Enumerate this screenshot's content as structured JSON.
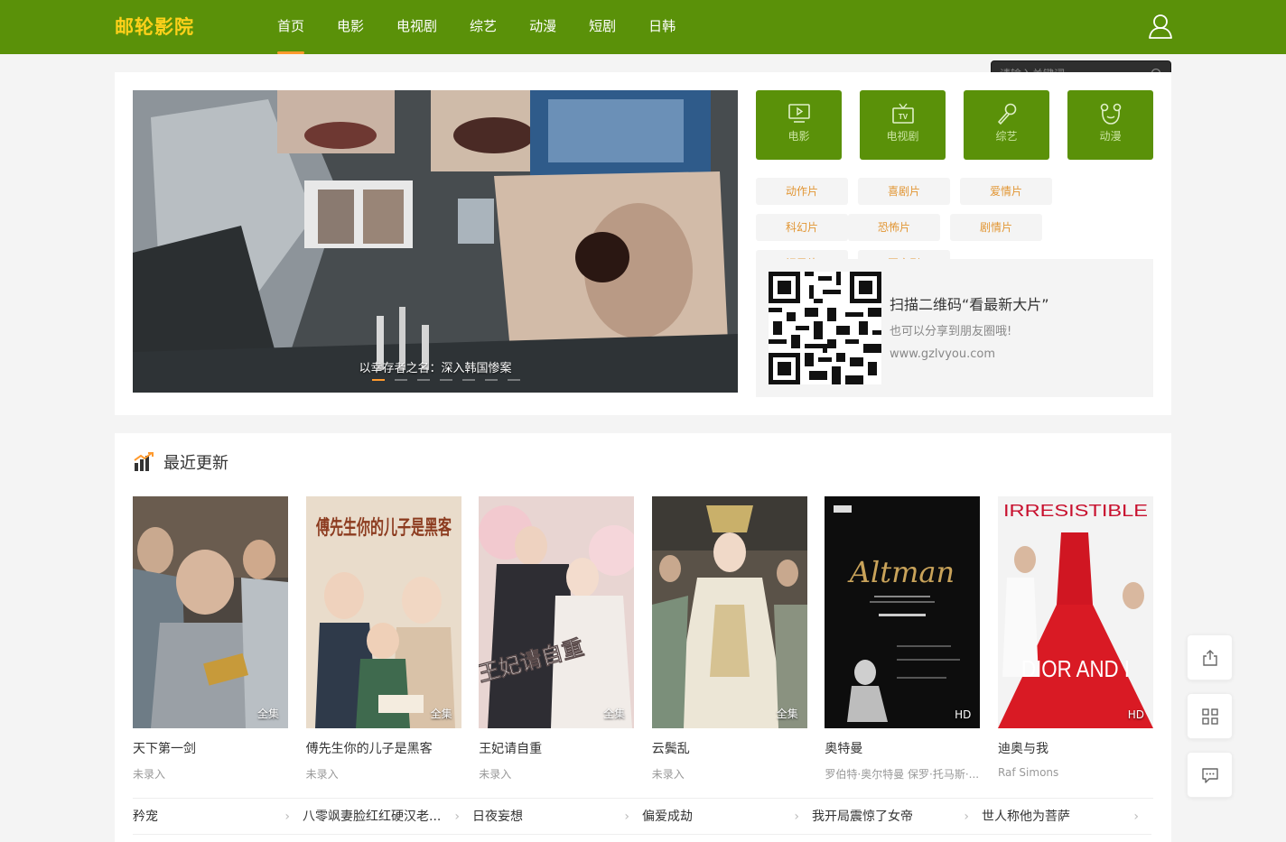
{
  "header": {
    "logo": "邮轮影院",
    "nav": [
      "首页",
      "电影",
      "电视剧",
      "综艺",
      "动漫",
      "短剧",
      "日韩"
    ],
    "active_nav": 0
  },
  "search": {
    "placeholder": "请输入关键词..."
  },
  "banner": {
    "caption": "以幸存者之名：深入韩国惨案",
    "slide_count": 7,
    "active_slide": 0
  },
  "categories": [
    {
      "label": "电影",
      "icon": "play-screen-icon"
    },
    {
      "label": "电视剧",
      "icon": "tv-icon"
    },
    {
      "label": "综艺",
      "icon": "microphone-icon"
    },
    {
      "label": "动漫",
      "icon": "bear-icon"
    }
  ],
  "genres": [
    "动作片",
    "喜剧片",
    "爱情片",
    "科幻片",
    "恐怖片",
    "剧情片",
    "记录片",
    "国产剧"
  ],
  "qr": {
    "title": "扫描二维码“看最新大片”",
    "subtitle": "也可以分享到朋友圈哦!",
    "url": "www.gzlvyou.com"
  },
  "recent": {
    "title": "最近更新",
    "items": [
      {
        "title": "天下第一剑",
        "sub": "未录入",
        "badge": "全集"
      },
      {
        "title": "傅先生你的儿子是黑客",
        "sub": "未录入",
        "badge": "全集",
        "poster_text": "傅先生你的儿子是黑客"
      },
      {
        "title": "王妃请自重",
        "sub": "未录入",
        "badge": "全集",
        "poster_text": "王妃请自重"
      },
      {
        "title": "云鬓乱",
        "sub": "未录入",
        "badge": "全集"
      },
      {
        "title": "奥特曼",
        "sub": "罗伯特·奥尔特曼 保罗·托马斯·...",
        "badge": "HD",
        "poster_text": "Altman"
      },
      {
        "title": "迪奥与我",
        "sub": "Raf Simons",
        "badge": "HD",
        "poster_text": "IRRESISTIBLE",
        "poster_text2": "DIOR AND I"
      }
    ],
    "more": [
      "矜宠",
      "八零飒妻脸红红硬汉老...",
      "日夜妄想",
      "偏爱成劫",
      "我开局震惊了女帝",
      "世人称他为菩萨"
    ]
  },
  "colors": {
    "brand": "#5a9109",
    "accent": "#ff9a2e",
    "logo": "#ffd11a"
  },
  "float_tools": [
    "share-icon",
    "qr-grid-icon",
    "chat-icon"
  ]
}
